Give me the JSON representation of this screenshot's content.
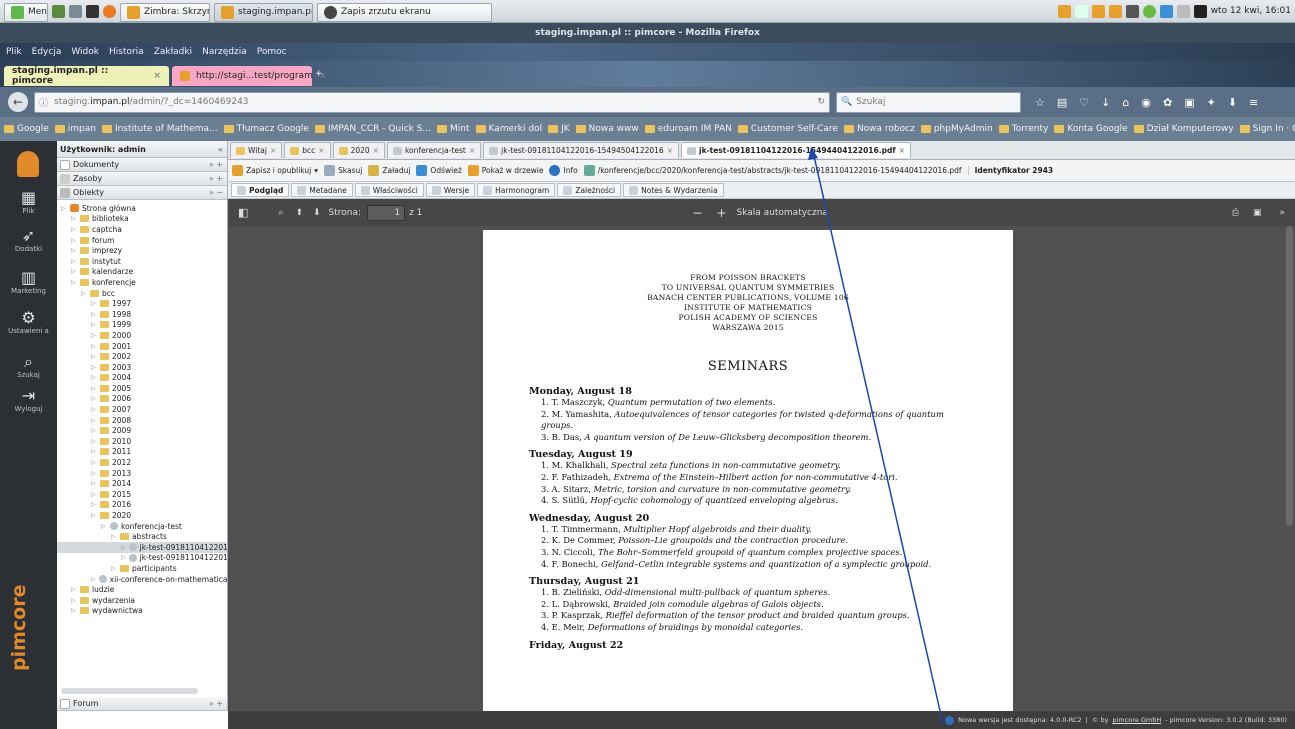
{
  "taskbar": {
    "menu": "Menu",
    "tasks": [
      "Zimbra: Skrzynka od...",
      "staging.impan.pl :: pi...",
      "Zapis zrzutu ekranu"
    ],
    "clock": "wto 12 kwi, 16:01"
  },
  "firefox": {
    "title": "staging.impan.pl :: pimcore - Mozilla Firefox",
    "menu": [
      "Plik",
      "Edycja",
      "Widok",
      "Historia",
      "Zakładki",
      "Narzędzia",
      "Pomoc"
    ],
    "tabs": [
      "staging.impan.pl :: pimcore",
      "http://stagi...test/program"
    ],
    "url_gray": "staging.",
    "url_host": "impan.pl",
    "url_path": "/admin/?_dc=1460469243",
    "search_placeholder": "Szukaj"
  },
  "bookmarks": [
    "Google",
    "impan",
    "Institute of Mathema...",
    "Tłumacz Google",
    "IMPAN_CCR - Quick S...",
    "Mint",
    "Kamerki dol",
    "JK",
    "Nowa www",
    "eduroam IM PAN",
    "Customer Self-Care",
    "Nowa robocz",
    "phpMyAdmin",
    "Torrenty",
    "Konta Google",
    "Dział Komputerowy",
    "Sign In · GitLab"
  ],
  "sidebar": {
    "items": [
      "Plik",
      "Dodatki",
      "Marketing",
      "Ustawieni a",
      "Szukaj",
      "Wyloguj"
    ],
    "logo": "pimcore"
  },
  "tree": {
    "user": "Użytkownik: admin",
    "sections": [
      "Dokumenty",
      "Zasoby",
      "Obiekty"
    ],
    "forum": "Forum",
    "nodes": [
      {
        "l": "Strona główna",
        "d": 0,
        "t": "home"
      },
      {
        "l": "biblioteka",
        "d": 1
      },
      {
        "l": "captcha",
        "d": 1
      },
      {
        "l": "forum",
        "d": 1
      },
      {
        "l": "imprezy",
        "d": 1
      },
      {
        "l": "instytut",
        "d": 1
      },
      {
        "l": "kalendarze",
        "d": 1
      },
      {
        "l": "konferencje",
        "d": 1
      },
      {
        "l": "bcc",
        "d": 2
      },
      {
        "l": "1997",
        "d": 3
      },
      {
        "l": "1998",
        "d": 3
      },
      {
        "l": "1999",
        "d": 3
      },
      {
        "l": "2000",
        "d": 3
      },
      {
        "l": "2001",
        "d": 3
      },
      {
        "l": "2002",
        "d": 3
      },
      {
        "l": "2003",
        "d": 3
      },
      {
        "l": "2004",
        "d": 3
      },
      {
        "l": "2005",
        "d": 3
      },
      {
        "l": "2006",
        "d": 3
      },
      {
        "l": "2007",
        "d": 3
      },
      {
        "l": "2008",
        "d": 3
      },
      {
        "l": "2009",
        "d": 3
      },
      {
        "l": "2010",
        "d": 3
      },
      {
        "l": "2011",
        "d": 3
      },
      {
        "l": "2012",
        "d": 3
      },
      {
        "l": "2013",
        "d": 3
      },
      {
        "l": "2014",
        "d": 3
      },
      {
        "l": "2015",
        "d": 3
      },
      {
        "l": "2016",
        "d": 3
      },
      {
        "l": "2020",
        "d": 3
      },
      {
        "l": "konferencja-test",
        "d": 4,
        "t": "doc"
      },
      {
        "l": "abstracts",
        "d": 5
      },
      {
        "l": "jk-test-0918110412201",
        "d": 6,
        "t": "doc",
        "sel": true
      },
      {
        "l": "jk-test-0918110412201",
        "d": 6,
        "t": "doc"
      },
      {
        "l": "participants",
        "d": 5
      },
      {
        "l": "xii-conference-on-mathematical-stati",
        "d": 3,
        "t": "doc"
      },
      {
        "l": "ludzie",
        "d": 1
      },
      {
        "l": "wydarzenia",
        "d": 1
      },
      {
        "l": "wydawnictwa",
        "d": 1
      }
    ]
  },
  "doctabs": [
    "Witaj",
    "bcc",
    "2020",
    "konferencja-test",
    "jk-test-09181104122016-15494504122016",
    "jk-test-09181104122016-15494404122016.pdf"
  ],
  "toolbar": {
    "save": "Zapisz i opublikuj",
    "delete": "Skasuj",
    "upload": "Załaduj",
    "refresh": "Odśwież",
    "show_tree": "Pokaż w drzewie",
    "info": "Info",
    "path": "/konferencje/bcc/2020/konferencja-test/abstracts/jk-test-09181104122016-15494404122016.pdf",
    "id": "Identyfikator 2943"
  },
  "subtabs": [
    "Podgląd",
    "Metadane",
    "Właściwości",
    "Wersje",
    "Harmonogram",
    "Zależności",
    "Notes & Wydarzenia"
  ],
  "pdf": {
    "page_label": "Strona:",
    "page": "1",
    "of": "z 1",
    "zoom": "Skala automatyczna",
    "header": [
      "FROM POISSON BRACKETS",
      "TO UNIVERSAL QUANTUM SYMMETRIES",
      "BANACH CENTER PUBLICATIONS, VOLUME 106",
      "INSTITUTE OF MATHEMATICS",
      "POLISH ACADEMY OF SCIENCES",
      "WARSZAWA 2015"
    ],
    "title": "SEMINARS",
    "days": [
      {
        "day": "Monday, August 18",
        "items": [
          {
            "a": "1. T. Maszczyk, ",
            "t": "Quantum permutation of two elements."
          },
          {
            "a": "2. M. Yamashita, ",
            "t": "Autoequivalences of tensor categories for twisted q-deformations of quantum groups."
          },
          {
            "a": "3. B. Das, ",
            "t": "A quantum version of De Leuw–Glicksberg decomposition theorem."
          }
        ]
      },
      {
        "day": "Tuesday, August 19",
        "items": [
          {
            "a": "1. M. Khalkhali, ",
            "t": "Spectral zeta functions in non-commutative geometry."
          },
          {
            "a": "2. F. Fathizadeh, ",
            "t": "Extrema of the Einstein–Hilbert action for non-commutative 4-tori."
          },
          {
            "a": "3. A. Sitarz, ",
            "t": "Metric, torsion and curvature in non-commutative geometry."
          },
          {
            "a": "4. S. Sütlü, ",
            "t": "Hopf-cyclic cohomology of quantized enveloping algebras."
          }
        ]
      },
      {
        "day": "Wednesday, August 20",
        "items": [
          {
            "a": "1. T. Timmermann, ",
            "t": "Multiplier Hopf algebroids and their duality."
          },
          {
            "a": "2. K. De Commer, ",
            "t": "Poisson–Lie groupoids and the contraction procedure."
          },
          {
            "a": "3. N. Ciccoli, ",
            "t": "The Bohr–Sommerfeld groupoid of quantum complex projective spaces."
          },
          {
            "a": "4. F. Bonechi, ",
            "t": "Gelfand–Cetlin integrable systems and quantization of a symplectic groupoid."
          }
        ]
      },
      {
        "day": "Thursday, August 21",
        "items": [
          {
            "a": "1. B. Zieliński, ",
            "t": "Odd-dimensional multi-pullback of quantum spheres."
          },
          {
            "a": "2. L. Dąbrowski, ",
            "t": "Braided join comodule algebras of Galois objects."
          },
          {
            "a": "3. P. Kasprzak, ",
            "t": "Rieffel deformation of the tensor product and braided quantum groups."
          },
          {
            "a": "4. E. Meir, ",
            "t": "Deformations of braidings by monoidal categories."
          }
        ]
      },
      {
        "day": "Friday, August 22",
        "items": []
      }
    ]
  },
  "status": {
    "msg": "Nowa wersja jest dostępna: 4.0.0-RC2",
    "by": "© by",
    "link": "pimcore GmbH",
    "ver": "- pimcore Version: 3.0.2 (Build: 3380)"
  }
}
